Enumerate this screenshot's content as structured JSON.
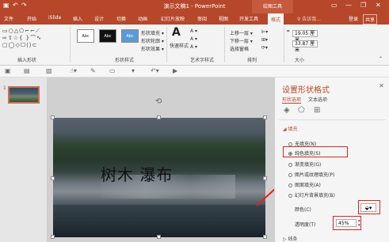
{
  "window": {
    "title": "演示文稿1 - PowerPoint",
    "context_tab": "绘图工具"
  },
  "tabs": [
    "文件",
    "开始",
    "iSlide",
    "插入",
    "设计",
    "切换",
    "动画",
    "幻灯片放映",
    "审阅",
    "视图",
    "开发工具",
    "格式"
  ],
  "tell_me": "♀ 告诉我...",
  "account": {
    "login": "登录",
    "share": "共享"
  },
  "ribbon": {
    "insert_shapes_label": "插入形状",
    "shape_styles_label": "形状样式",
    "wordart_label": "艺术字样式",
    "arrange_label": "排列",
    "size_label": "大小",
    "style_swatches": [
      "Abc",
      "Abc",
      "Abc"
    ],
    "shape_fill": "形状填充 ▾",
    "shape_outline": "形状轮廓 ▾",
    "shape_effects": "形状效果 ▾",
    "quick_styles": "快速样式",
    "bring_forward": "上移一层 ▾",
    "send_backward": "下移一层 ▾",
    "selection_pane": "选择窗格",
    "height": "19.05 厘米",
    "width": "33.87 厘米"
  },
  "slide": {
    "number": "1",
    "text": "树木  瀑布"
  },
  "format_pane": {
    "title": "设置形状格式",
    "tab_shape": "形状选项",
    "tab_text": "文本选项",
    "fill_section": "◢ 填充",
    "options": [
      {
        "label": "无填充(N)",
        "selected": false
      },
      {
        "label": "纯色填充(S)",
        "selected": true
      },
      {
        "label": "渐变填充(G)",
        "selected": false
      },
      {
        "label": "图片或纹理填充(P)",
        "selected": false
      },
      {
        "label": "图案填充(A)",
        "selected": false
      },
      {
        "label": "幻灯片背景填充(B)",
        "selected": false
      }
    ],
    "color_label": "颜色(C)",
    "transparency_label": "透明度(T)",
    "transparency_value": "45%",
    "line_section": "▷ 线条"
  },
  "colors": {
    "accent": "#b7472a",
    "highlight": "#e0231b"
  }
}
